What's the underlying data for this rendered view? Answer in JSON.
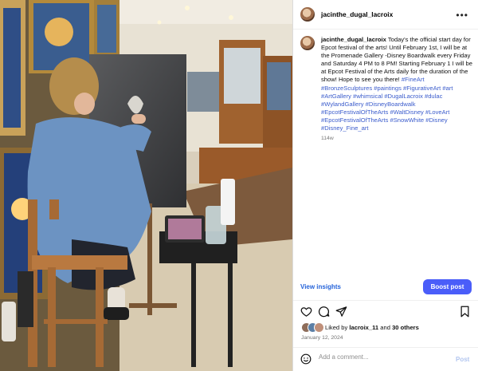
{
  "post": {
    "username": "jacinthe_dugal_lacroix",
    "more_icon": "ellipsis-icon",
    "caption_user": "jacinthe_dugal_lacroix",
    "caption_text": "Today's the official start day for Epcot festival of the arts! Until February 1st, I will be at the Promenade Gallery -Disney Boardwalk every Friday and Saturday 4 PM to 8 PM! Starting February 1 I will be at Epcot Festival of the Arts daily for the duration of the show! Hope to see you there!",
    "hashtags": "#FineArt #BronzeSculptures #paintings #FigurativeArt #art #ArtGallery #whimsical #DugalLacroix #dulac #WylandGallery #DisneyBoardwalk #EpcotFestivalOfTheArts #WaltDisney #LoveArt #EpcotFestivalOfTheArts #SnowWhite #Disney #Disney_Fine_art",
    "time_ago": "114w"
  },
  "actions": {
    "view_insights": "View insights",
    "boost_post": "Boost post",
    "icons": [
      "heart-icon",
      "comment-icon",
      "share-icon",
      "bookmark-icon"
    ]
  },
  "likes": {
    "prefix": "Liked by",
    "user": "lacroix_11",
    "middle": "and",
    "others": "30 others",
    "date": "January 12, 2024"
  },
  "comment_box": {
    "placeholder": "Add a comment...",
    "post_label": "Post"
  },
  "colors": {
    "accent": "#4a5df9",
    "link": "#3b5ccc",
    "insights": "#2563d9"
  }
}
